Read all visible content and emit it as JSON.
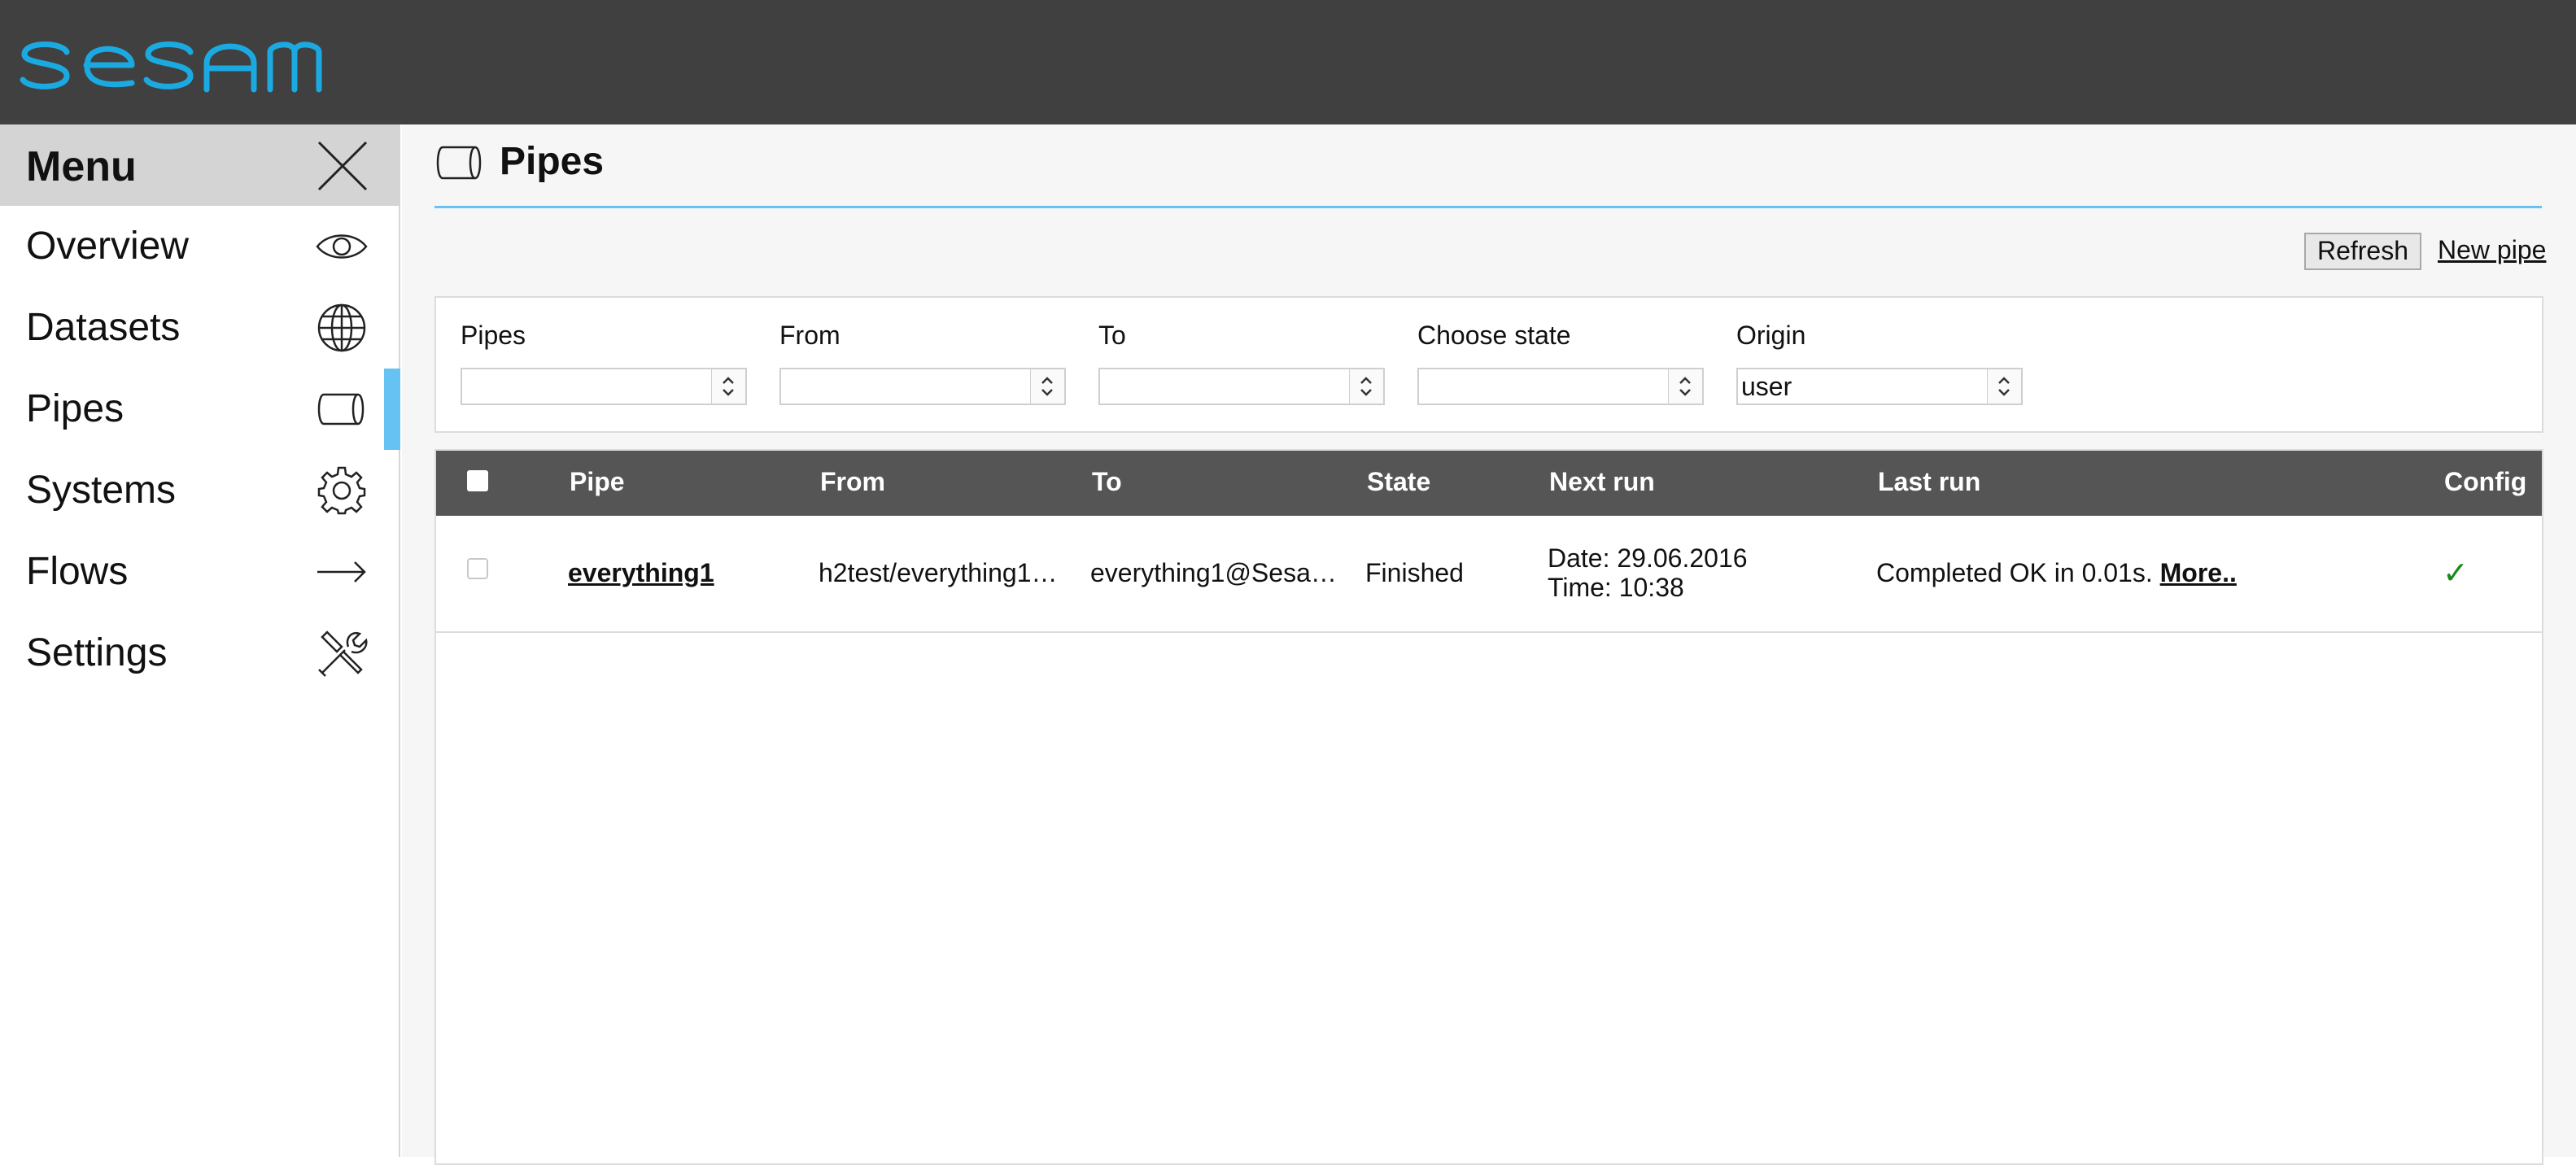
{
  "app": {
    "logo_text": "sesam"
  },
  "sidebar": {
    "menu_title": "Menu",
    "items": [
      {
        "label": "Overview",
        "icon": "eye-icon"
      },
      {
        "label": "Datasets",
        "icon": "globe-icon"
      },
      {
        "label": "Pipes",
        "icon": "pipe-icon",
        "active": true
      },
      {
        "label": "Systems",
        "icon": "gear-icon"
      },
      {
        "label": "Flows",
        "icon": "arrow-right-icon"
      },
      {
        "label": "Settings",
        "icon": "tools-icon"
      }
    ]
  },
  "page": {
    "title": "Pipes"
  },
  "toolbar": {
    "refresh_label": "Refresh",
    "new_pipe_label": "New pipe"
  },
  "filters": [
    {
      "label": "Pipes",
      "value": ""
    },
    {
      "label": "From",
      "value": ""
    },
    {
      "label": "To",
      "value": ""
    },
    {
      "label": "Choose state",
      "value": ""
    },
    {
      "label": "Origin",
      "value": "user"
    }
  ],
  "table": {
    "columns": [
      "Pipe",
      "From",
      "To",
      "State",
      "Next run",
      "Last run",
      "Config"
    ],
    "rows": [
      {
        "pipe": "everything1",
        "from": "h2test/everything1…",
        "to": "everything1@Sesa…",
        "state": "Finished",
        "next_run_date": "Date: 29.06.2016",
        "next_run_time": "Time: 10:38",
        "last_run": "Completed OK in 0.01s.",
        "last_run_more": "More..",
        "config": "✓"
      }
    ]
  },
  "colors": {
    "topbar": "#404040",
    "accent": "#66c2f2",
    "logo": "#1ba9e1",
    "table_header": "#555555",
    "config_ok": "#1a8a1a"
  }
}
